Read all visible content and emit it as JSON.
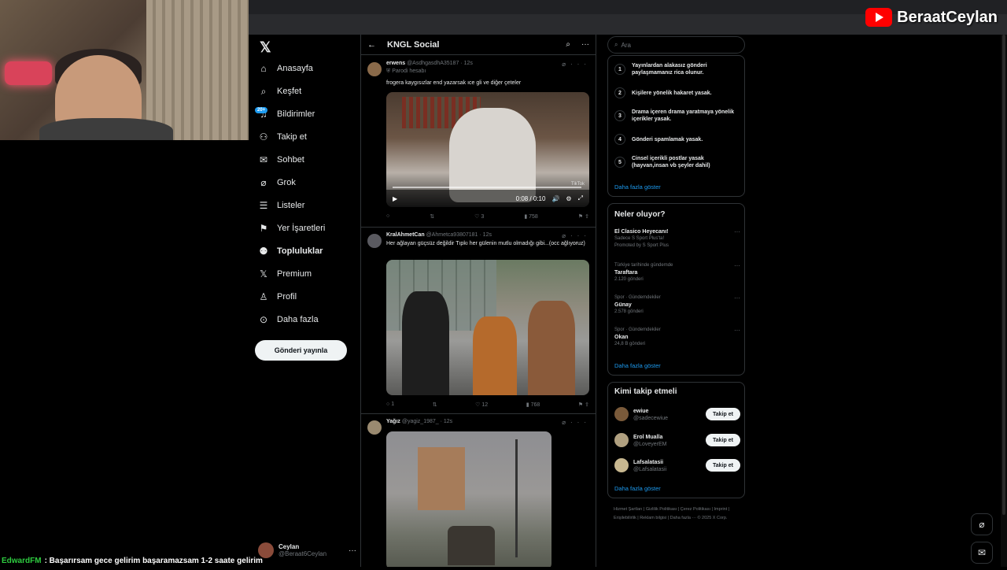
{
  "brand": {
    "name": "BeraatCeylan"
  },
  "nav": {
    "logo": "𝕏",
    "items": [
      {
        "label": "Anasayfa",
        "icon": "⌂",
        "name": "home"
      },
      {
        "label": "Keşfet",
        "icon": "⌕",
        "name": "explore"
      },
      {
        "label": "Bildirimler",
        "icon": "♫",
        "name": "notifications",
        "badge": "20+"
      },
      {
        "label": "Takip et",
        "icon": "⚇",
        "name": "follow"
      },
      {
        "label": "Sohbet",
        "icon": "✉",
        "name": "chat"
      },
      {
        "label": "Grok",
        "icon": "⌀",
        "name": "grok"
      },
      {
        "label": "Listeler",
        "icon": "☰",
        "name": "lists"
      },
      {
        "label": "Yer İşaretleri",
        "icon": "⚑",
        "name": "bookmarks"
      },
      {
        "label": "Topluluklar",
        "icon": "⚉",
        "name": "communities"
      },
      {
        "label": "Premium",
        "icon": "𝕏",
        "name": "premium"
      },
      {
        "label": "Profil",
        "icon": "♙",
        "name": "profile"
      },
      {
        "label": "Daha fazla",
        "icon": "⊙",
        "name": "more"
      }
    ],
    "post_button": "Gönderi yayınla",
    "account": {
      "name": "Ceylan",
      "handle": "@Beraat6Ceylan",
      "more": "···"
    }
  },
  "feed": {
    "title": "KNGL Social",
    "posts": [
      {
        "name": "erwens",
        "handle": "@AsdhgasdhA35187",
        "time": "· 12s",
        "parody": "Parodi hesabı",
        "text": "frogera kaygısızlar end yazarsak ıce gli ve diğer çeteler",
        "video_time": "0:08 / 0:10",
        "video_tag": "TikTok",
        "actions": {
          "reply": "",
          "repost": "",
          "like": "3",
          "views": "758"
        }
      },
      {
        "name": "KralAhmetCan",
        "handle": "@Ahmetca93807181",
        "time": "· 12s",
        "text": "Her ağlayan güçsüz değildir Tıpkı her gülenin mutlu olmadığı gibi...(occ ağlıyoruz)",
        "actions": {
          "reply": "1",
          "repost": "",
          "like": "12",
          "views": "768"
        }
      },
      {
        "name": "Yağız",
        "handle": "@yagiz_1987_",
        "time": "· 12s",
        "text": ""
      }
    ]
  },
  "right": {
    "search_placeholder": "Ara",
    "rules": [
      {
        "num": "1",
        "text": "Yayınlardan alakasız gönderi paylaşmamanız rica olunur."
      },
      {
        "num": "2",
        "text": "Kişilere yönelik hakaret yasak."
      },
      {
        "num": "3",
        "text": "Drama içeren drama yaratmaya yönelik içerikler yasak."
      },
      {
        "num": "4",
        "text": "Gönderi spamlamak yasak."
      },
      {
        "num": "5",
        "text": "Cinsel içerikli postlar yasak (hayvan,insan vb şeyler dahil)"
      }
    ],
    "rules_more": "Daha fazla göster",
    "trends_title": "Neler oluyor?",
    "trends": [
      {
        "title": "El Clasico Heyecanı!",
        "line1": "Sadece S Sport Plus'ta!",
        "line2": "Promoted by S Sport Plus"
      },
      {
        "category": "Türkiye tarihinde gündemde",
        "title": "Taraftara",
        "count": "2.120 gönderi"
      },
      {
        "category": "Spor · Gündemdekiler",
        "title": "Günay",
        "count": "2.578 gönderi"
      },
      {
        "category": "Spor · Gündemdekiler",
        "title": "Okan",
        "count": "24,8 B gönderi"
      }
    ],
    "trends_more": "Daha fazla göster",
    "follow_title": "Kimi takip etmeli",
    "follows": [
      {
        "name": "ewiue",
        "handle": "@sadecewiue",
        "button": "Takip et"
      },
      {
        "name": "Erol Mualla",
        "handle": "@LoveyerEM",
        "button": "Takip et"
      },
      {
        "name": "Lafsalatasii",
        "handle": "@Lafsalatasii",
        "button": "Takip et"
      }
    ],
    "follow_more": "Daha fazla göster",
    "footer": "Hizmet Şartları | Gizlilik Politikası | Çerez Politikası | Imprint | Erişilebilirlik | Reklam bilgisi | Daha fazla ··· © 2025 X Corp."
  },
  "chat": {
    "user": "EdwardFM",
    "message": ": Başarırsam gece gelirim başaramazsam 1-2 saate gelirim"
  },
  "colors": {
    "accent": "#1d9bf0",
    "bg": "#000000",
    "border": "#2f3336",
    "muted": "#71767b"
  }
}
